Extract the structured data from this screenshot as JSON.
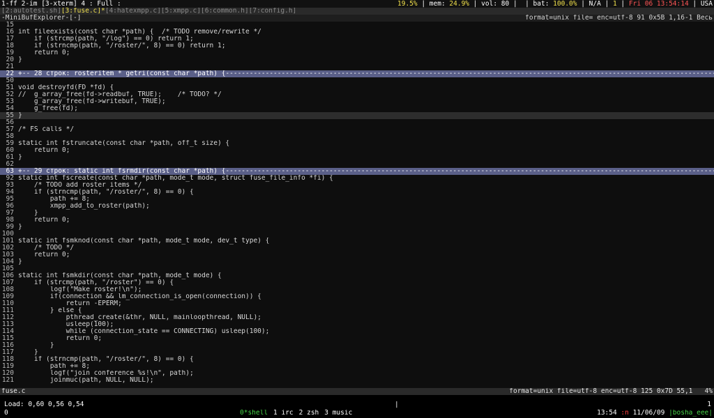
{
  "top_bar": {
    "left": "1-ff 2-im [3-xterm] 4 : Full :",
    "cpu": "19.5%",
    "mem_label": " | mem: ",
    "mem": "24.9%",
    "vol_label": " | vol: ",
    "vol": "80",
    "bat_label": " |  | bat: ",
    "bat": "100.0%",
    "na_label": " | N/A | ",
    "na_value": "1",
    "date_sep": " | ",
    "date": "Fri 06 13:54:14",
    "tail": " | USA"
  },
  "buffer_tabs": [
    {
      "label": "[2:autotest.sh]",
      "active": false
    },
    {
      "label": "[3:fuse.c]*",
      "active": true
    },
    {
      "label": "[4:hatexmpp.c]",
      "active": false
    },
    {
      "label": "[5:xmpp.c]",
      "active": false
    },
    {
      "label": "[6:common.h]",
      "active": false
    },
    {
      "label": "[7:config.h]",
      "active": false
    }
  ],
  "minibuf": {
    "title": "-MiniBufExplorer-[-]",
    "info": "format=unix file= enc=utf-8 91 0x5B 1,16-1 Весь"
  },
  "code_lines": [
    {
      "num": "15",
      "text": ""
    },
    {
      "num": "16",
      "text": "int fileexists(const char *path) {  /* TODO remove/rewrite */"
    },
    {
      "num": "17",
      "text": "    if (strcmp(path, \"/log\") == 0) return 1;"
    },
    {
      "num": "18",
      "text": "    if (strncmp(path, \"/roster/\", 8) == 0) return 1;"
    },
    {
      "num": "19",
      "text": "    return 0;"
    },
    {
      "num": "20",
      "text": "}"
    },
    {
      "num": "21",
      "text": ""
    },
    {
      "num": "22",
      "text": "+-- 28 строк: rosteritem * getri(const char *path) {---------------------------------------------------------------------------------------------------------------------------------------"
    },
    {
      "num": "50",
      "text": ""
    },
    {
      "num": "51",
      "text": "void destroyfd(FD *fd) {"
    },
    {
      "num": "52",
      "text": "//  g_array_free(fd->readbuf, TRUE);    /* TODO? */"
    },
    {
      "num": "53",
      "text": "    g_array_free(fd->writebuf, TRUE);"
    },
    {
      "num": "54",
      "text": "    g_free(fd);"
    },
    {
      "num": "55",
      "text": "}"
    },
    {
      "num": "56",
      "text": ""
    },
    {
      "num": "57",
      "text": "/* FS calls */"
    },
    {
      "num": "58",
      "text": ""
    },
    {
      "num": "59",
      "text": "static int fstruncate(const char *path, off_t size) {"
    },
    {
      "num": "60",
      "text": "    return 0;"
    },
    {
      "num": "61",
      "text": "}"
    },
    {
      "num": "62",
      "text": ""
    },
    {
      "num": "63",
      "text": "+-- 29 строк: static int fsrmdir(const char *path) {---------------------------------------------------------------------------------------------------------------------------------------"
    },
    {
      "num": "92",
      "text": "static int fscreate(const char *path, mode_t mode, struct fuse_file_info *fi) {"
    },
    {
      "num": "93",
      "text": "    /* TODO add roster items */"
    },
    {
      "num": "94",
      "text": "    if (strncmp(path, \"/roster/\", 8) == 0) {"
    },
    {
      "num": "95",
      "text": "        path += 8;"
    },
    {
      "num": "96",
      "text": "        xmpp_add_to_roster(path);"
    },
    {
      "num": "97",
      "text": "    }"
    },
    {
      "num": "98",
      "text": "    return 0;"
    },
    {
      "num": "99",
      "text": "}"
    },
    {
      "num": "100",
      "text": ""
    },
    {
      "num": "101",
      "text": "static int fsmknod(const char *path, mode_t mode, dev_t type) {"
    },
    {
      "num": "102",
      "text": "    /* TODO */"
    },
    {
      "num": "103",
      "text": "    return 0;"
    },
    {
      "num": "104",
      "text": "}"
    },
    {
      "num": "105",
      "text": ""
    },
    {
      "num": "106",
      "text": "static int fsmkdir(const char *path, mode_t mode) {"
    },
    {
      "num": "107",
      "text": "    if (strcmp(path, \"/roster\") == 0) {"
    },
    {
      "num": "108",
      "text": "        logf(\"Make roster!\\n\");"
    },
    {
      "num": "109",
      "text": "        if(connection && lm_connection_is_open(connection)) {"
    },
    {
      "num": "110",
      "text": "            return -EPERM;"
    },
    {
      "num": "111",
      "text": "        } else {"
    },
    {
      "num": "112",
      "text": "            pthread_create(&thr, NULL, mainloopthread, NULL);"
    },
    {
      "num": "113",
      "text": "            usleep(100);"
    },
    {
      "num": "114",
      "text": "            while (connection_state == CONNECTING) usleep(100);"
    },
    {
      "num": "115",
      "text": "            return 0;"
    },
    {
      "num": "116",
      "text": "        }"
    },
    {
      "num": "117",
      "text": "    }"
    },
    {
      "num": "118",
      "text": "    if (strncmp(path, \"/roster/\", 8) == 0) {"
    },
    {
      "num": "119",
      "text": "        path += 8;"
    },
    {
      "num": "120",
      "text": "        logf(\"join conference %s!\\n\", path);"
    },
    {
      "num": "121",
      "text": "        joinmuc(path, NULL, NULL);"
    }
  ],
  "status_line": {
    "filename": "fuse.c",
    "info": "format=unix file=utf-8 enc=utf-8 125 0x7D 55,1   4%"
  },
  "screen_bar": {
    "load": "Load: 0,60 0,56 0,54",
    "center_mark": "|",
    "right_count": "1",
    "window_number": "0",
    "windows": [
      {
        "label": "0*shell",
        "current": true
      },
      {
        "label": "1 irc",
        "current": false
      },
      {
        "label": "2 zsh",
        "current": false
      },
      {
        "label": "3 music",
        "current": false
      }
    ],
    "time": "13:54",
    "time_sep": " :n ",
    "date": "11/06/09",
    "host": " |bosha_eee|"
  }
}
